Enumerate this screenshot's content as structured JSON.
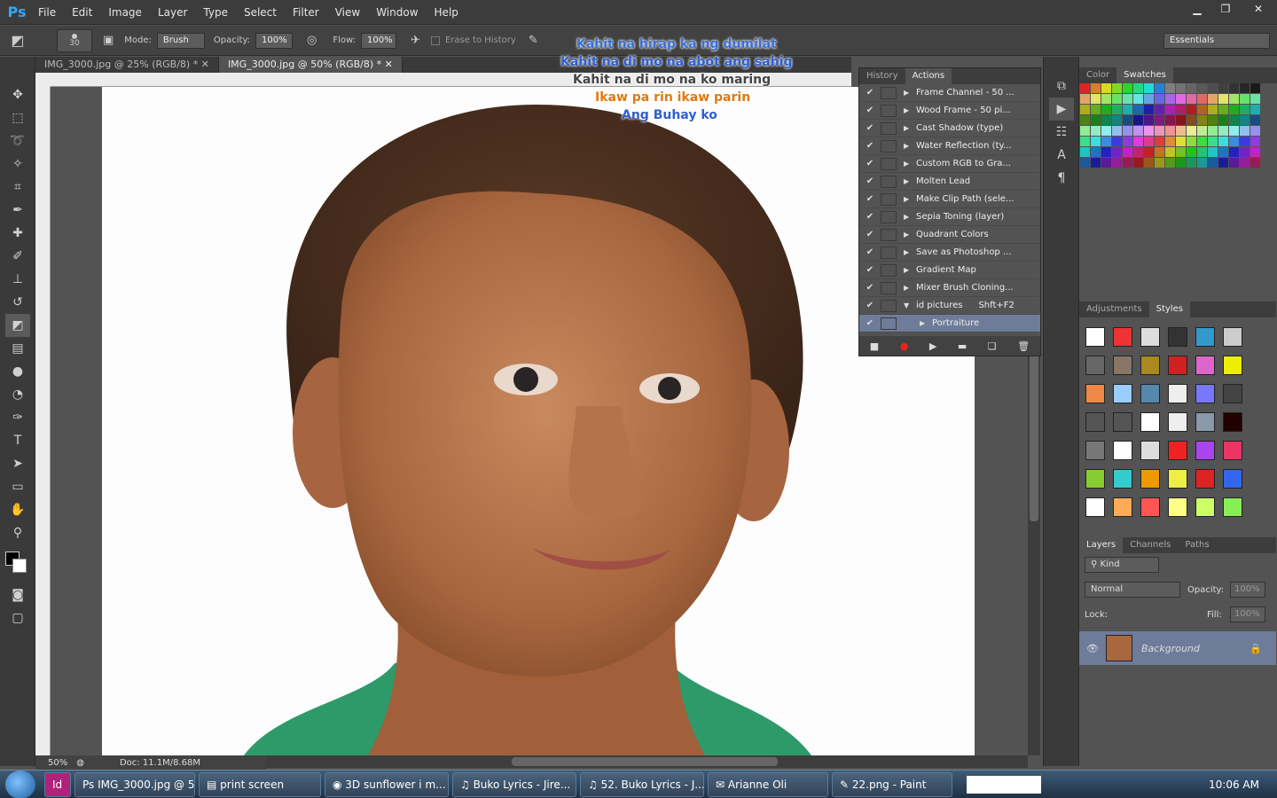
{
  "app": {
    "logo": "Ps"
  },
  "menu": [
    "File",
    "Edit",
    "Image",
    "Layer",
    "Type",
    "Select",
    "Filter",
    "View",
    "Window",
    "Help"
  ],
  "options": {
    "size": "30",
    "mode_label": "Mode:",
    "mode": "Brush",
    "opacity_label": "Opacity:",
    "opacity": "100%",
    "flow_label": "Flow:",
    "flow": "100%",
    "erase_history": "Erase to History",
    "workspace": "Essentials"
  },
  "tabs": [
    {
      "label": "IMG_3000.jpg @ 25% (RGB/8) *"
    },
    {
      "label": "IMG_3000.jpg @ 50% (RGB/8) *"
    }
  ],
  "lyrics": [
    {
      "text": "Kahit na hirap ka ng dumilat",
      "color": "#3a6fd8"
    },
    {
      "text": "Kahit na di mo na abot ang sahig",
      "color": "#2f5fcf"
    },
    {
      "text": "Kahit na di mo na ko maring",
      "color": "#444444"
    },
    {
      "text": "Ikaw pa rin ikaw parin",
      "color": "#e07a10"
    },
    {
      "text": "Ang Buhay ko",
      "color": "#2f5fcf"
    }
  ],
  "status": {
    "zoom": "50%",
    "doc": "Doc: 11.1M/8.68M"
  },
  "actions_panel": {
    "tab_history": "History",
    "tab_actions": "Actions",
    "items": [
      "Frame Channel - 50 ...",
      "Wood Frame - 50 pi...",
      "Cast Shadow (type)",
      "Water Reflection (ty...",
      "Custom RGB to Gra...",
      "Molten Lead",
      "Make Clip Path (sele...",
      "Sepia Toning (layer)",
      "Quadrant Colors",
      "Save as Photoshop ...",
      "Gradient Map",
      "Mixer Brush Cloning..."
    ],
    "set_name": "id pictures",
    "set_shortcut": "Shft+F2",
    "sub_item": "Portraiture"
  },
  "color_panel": {
    "tab_color": "Color",
    "tab_swatches": "Swatches"
  },
  "adjust_panel": {
    "tab_adjust": "Adjustments",
    "tab_styles": "Styles"
  },
  "layers_panel": {
    "tab_layers": "Layers",
    "tab_channels": "Channels",
    "tab_paths": "Paths",
    "kind": "Kind",
    "blend": "Normal",
    "opacity_label": "Opacity:",
    "opacity": "100%",
    "lock_label": "Lock:",
    "fill_label": "Fill:",
    "fill": "100%",
    "layer_name": "Background"
  },
  "taskbar": {
    "items": [
      "IMG_3000.jpg @ 5...",
      "print screen",
      "3D sunflower i m...",
      "Buko Lyrics - Jire...",
      "52. Buko Lyrics - J...",
      "Arianne Oli",
      "22.png - Paint"
    ],
    "clock": "10:06 AM"
  }
}
